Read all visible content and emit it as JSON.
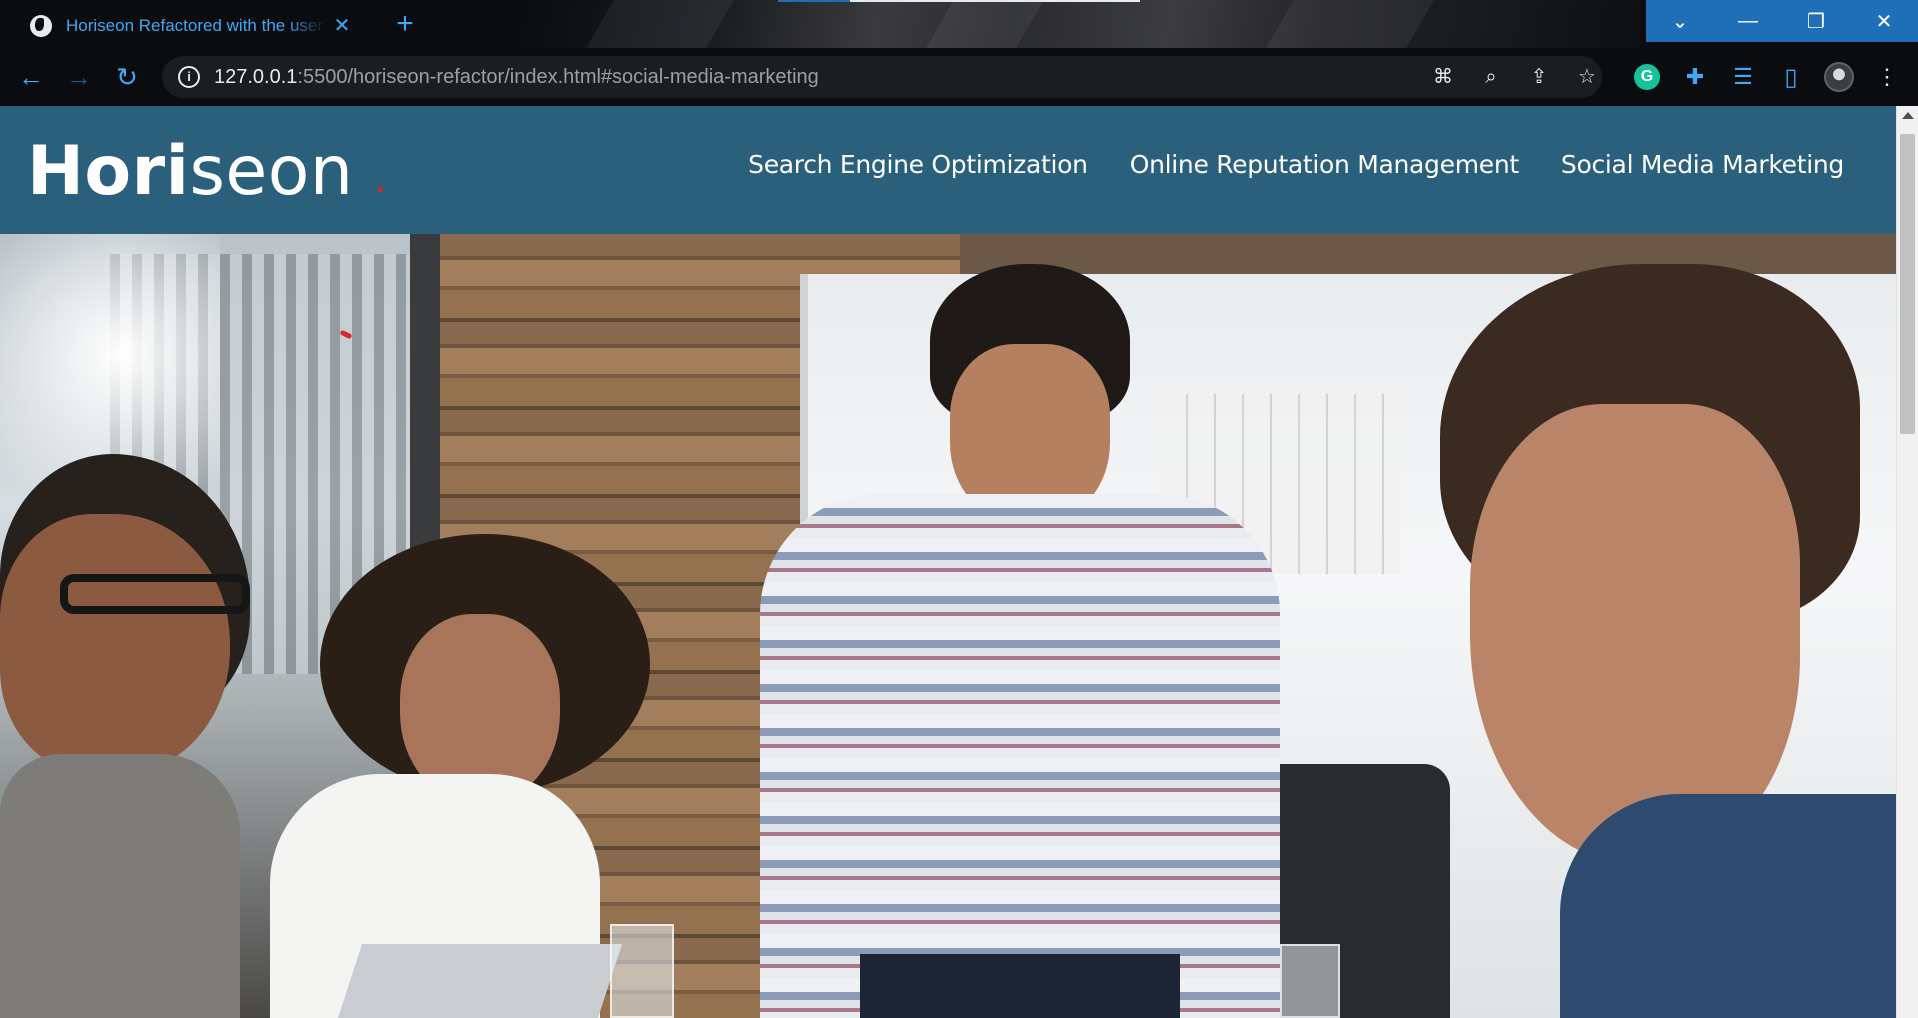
{
  "browser": {
    "tab": {
      "title": "Horiseon Refactored with the user",
      "close_glyph": "✕",
      "favicon": "globe-icon"
    },
    "new_tab_glyph": "+",
    "window_controls": {
      "tab_search_glyph": "⌄",
      "minimize_glyph": "—",
      "restore_glyph": "❐",
      "close_glyph": "✕"
    },
    "toolbar": {
      "back_glyph": "←",
      "forward_glyph": "→",
      "reload_glyph": "↻",
      "site_info_glyph": "i",
      "url_host": "127.0.0.1",
      "url_rest": ":5500/horiseon-refactor/index.html#social-media-marketing",
      "icons": [
        "translate-icon",
        "zoom-icon",
        "share-icon",
        "bookmark-star-icon",
        "grammarly-icon",
        "extensions-icon",
        "reading-list-icon",
        "side-panel-icon",
        "profile-avatar"
      ],
      "translate_glyph": "⌘",
      "zoom_glyph": "⌕",
      "share_glyph": "⇪",
      "star_glyph": "☆",
      "grammarly_letter": "G",
      "extensions_glyph": "✚",
      "reading_list_glyph": "☰",
      "side_panel_glyph": "▯",
      "menu_glyph": "⋮"
    },
    "colors": {
      "chrome_bg": "#0a0c10",
      "accent": "#3fa9f5",
      "window_controls": "#1e6fb8"
    }
  },
  "page": {
    "header": {
      "logo_main": "Hori",
      "logo_rest": "seon",
      "nav": [
        {
          "label": "Search Engine Optimization"
        },
        {
          "label": "Online Reputation Management"
        },
        {
          "label": "Social Media Marketing"
        }
      ],
      "background": "#2a607c"
    },
    "hero": {
      "description": "team-meeting-photo"
    }
  }
}
